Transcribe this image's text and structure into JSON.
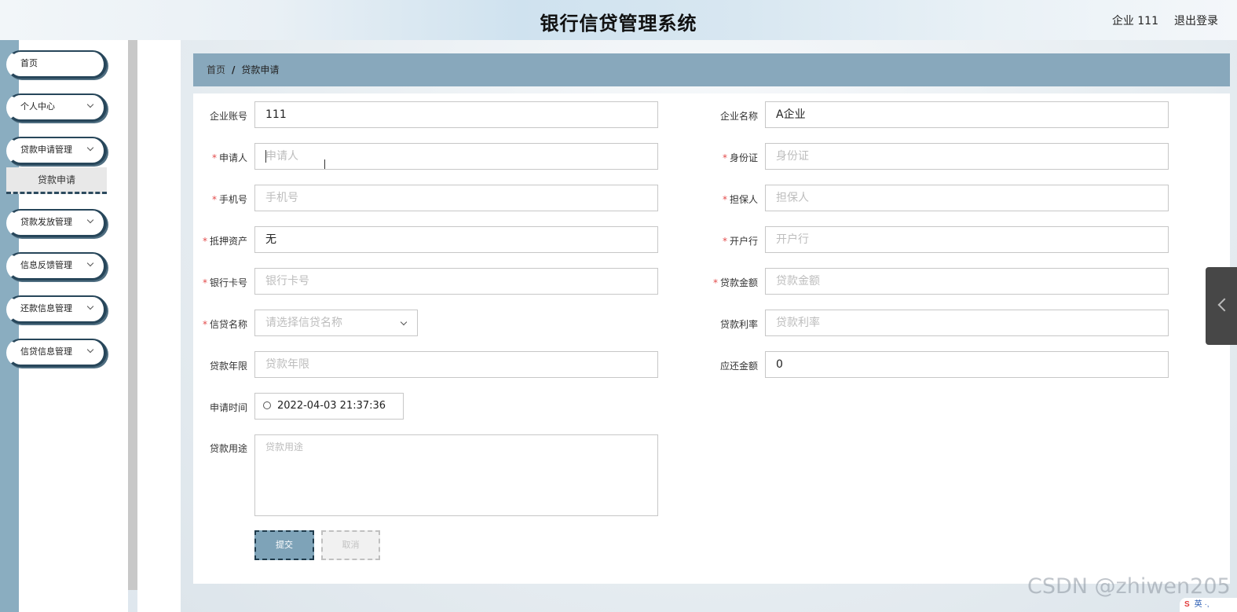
{
  "header": {
    "title": "银行信贷管理系统",
    "user": "企业 111",
    "logout": "退出登录"
  },
  "sidebar": {
    "items": [
      {
        "label": "首页"
      },
      {
        "label": "个人中心"
      },
      {
        "label": "贷款申请管理"
      },
      {
        "label": "贷款发放管理"
      },
      {
        "label": "信息反馈管理"
      },
      {
        "label": "还款信息管理"
      },
      {
        "label": "信贷信息管理"
      }
    ],
    "submenu": {
      "label": "贷款申请"
    }
  },
  "breadcrumb": {
    "home": "首页",
    "separator": "/",
    "current": "贷款申请"
  },
  "form": {
    "company_account": {
      "label": "企业账号",
      "value": "111"
    },
    "company_name": {
      "label": "企业名称",
      "value": "A企业"
    },
    "applicant": {
      "label": "申请人",
      "placeholder": "申请人"
    },
    "id_card": {
      "label": "身份证",
      "placeholder": "身份证"
    },
    "phone": {
      "label": "手机号",
      "placeholder": "手机号"
    },
    "guarantor": {
      "label": "担保人",
      "placeholder": "担保人"
    },
    "collateral": {
      "label": "抵押资产",
      "value": "无"
    },
    "bank": {
      "label": "开户行",
      "placeholder": "开户行"
    },
    "card_no": {
      "label": "银行卡号",
      "placeholder": "银行卡号"
    },
    "loan_amount": {
      "label": "贷款金额",
      "placeholder": "贷款金额"
    },
    "credit_name": {
      "label": "信贷名称",
      "placeholder": "请选择信贷名称"
    },
    "rate": {
      "label": "贷款利率",
      "placeholder": "贷款利率"
    },
    "years": {
      "label": "贷款年限",
      "placeholder": "贷款年限"
    },
    "repay": {
      "label": "应还金额",
      "value": "0"
    },
    "apply_time": {
      "label": "申请时间",
      "value": "2022-04-03 21:37:36"
    },
    "purpose": {
      "label": "贷款用途",
      "placeholder": "贷款用途"
    },
    "required_mark": "*",
    "submit": "提交",
    "cancel": "取消"
  },
  "watermark": "CSDN @zhiwen205",
  "ime": {
    "logo": "S",
    "text": "英 ·,"
  }
}
